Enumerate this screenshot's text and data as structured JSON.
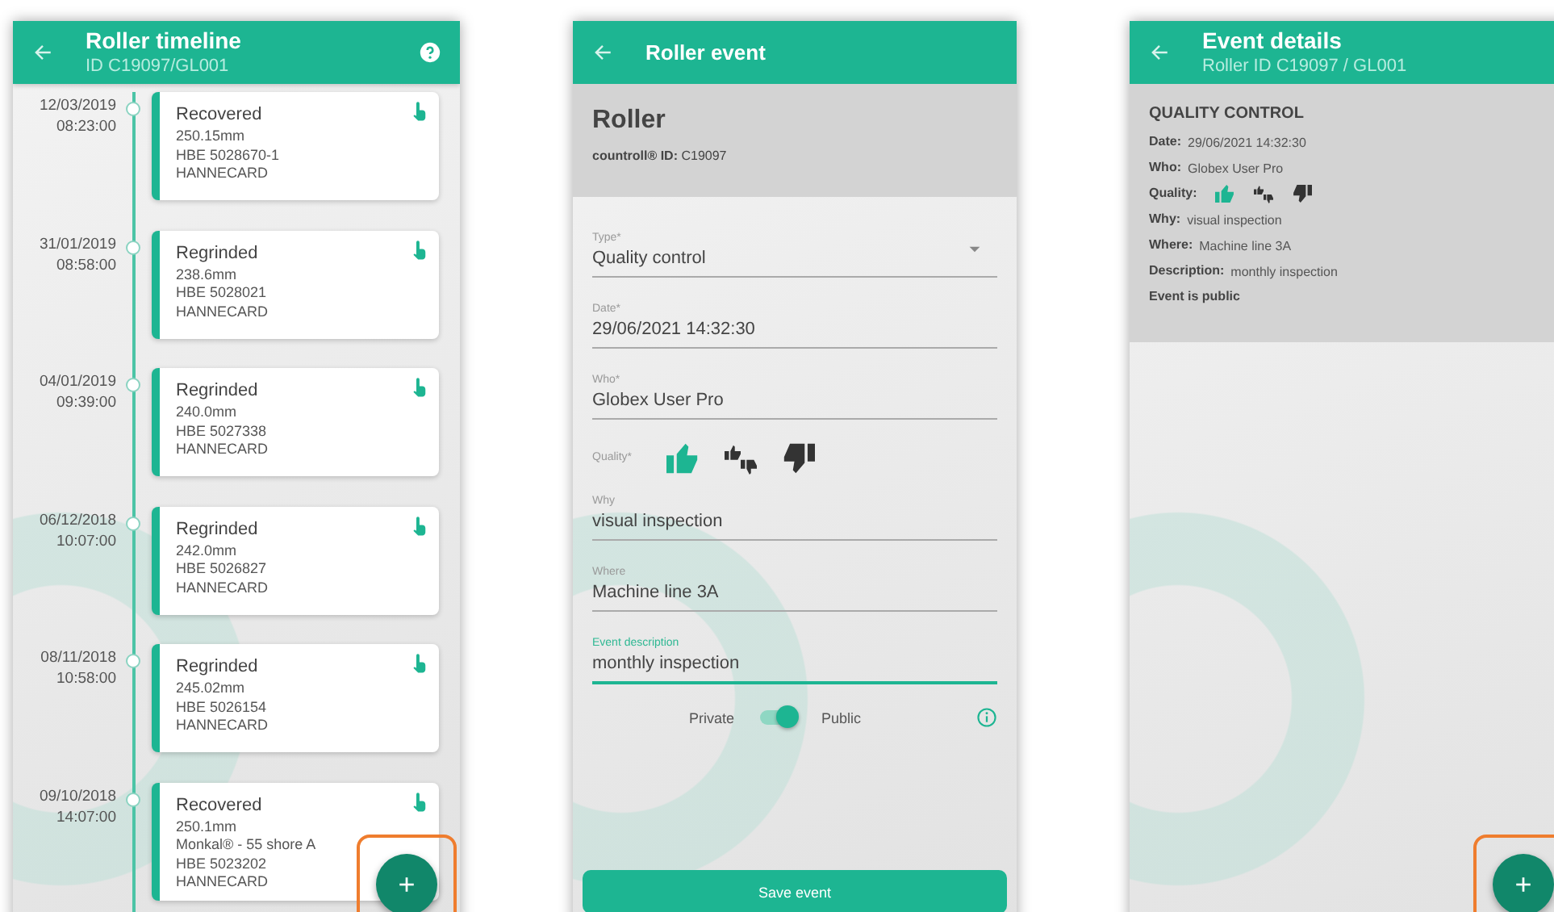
{
  "timeline": {
    "title": "Roller timeline",
    "subtitle": "ID C19097/GL001",
    "events": [
      {
        "date": "12/03/2019",
        "time": "08:23:00",
        "type": "Recovered",
        "lines": [
          "250.15mm",
          "HBE 5028670-1",
          "HANNECARD"
        ]
      },
      {
        "date": "31/01/2019",
        "time": "08:58:00",
        "type": "Regrinded",
        "lines": [
          "238.6mm",
          "HBE 5028021",
          "HANNECARD"
        ]
      },
      {
        "date": "04/01/2019",
        "time": "09:39:00",
        "type": "Regrinded",
        "lines": [
          "240.0mm",
          "HBE 5027338",
          "HANNECARD"
        ]
      },
      {
        "date": "06/12/2018",
        "time": "10:07:00",
        "type": "Regrinded",
        "lines": [
          "242.0mm",
          "HBE 5026827",
          "HANNECARD"
        ]
      },
      {
        "date": "08/11/2018",
        "time": "10:58:00",
        "type": "Regrinded",
        "lines": [
          "245.02mm",
          "HBE 5026154",
          "HANNECARD"
        ]
      },
      {
        "date": "09/10/2018",
        "time": "14:07:00",
        "type": "Recovered",
        "lines": [
          "250.1mm",
          "Monkal® - 55 shore A",
          "HBE 5023202",
          "HANNECARD"
        ]
      }
    ],
    "fab": {
      "label": "+",
      "highlighted": true
    }
  },
  "event_form": {
    "title": "Roller event",
    "heading": "Roller",
    "id_line": "**countroll® ID:** C19097",
    "fields": [
      {
        "kind": "select",
        "label": "Type*",
        "value": "Quality control",
        "focused": false
      },
      {
        "kind": "text",
        "label": "Date*",
        "value": "29/06/2021 14:32:30",
        "focused": false
      },
      {
        "kind": "text",
        "label": "Who*",
        "value": "Globex User Pro",
        "focused": false
      },
      {
        "kind": "quality",
        "label": "Quality*",
        "options": [
          {
            "kind": "good",
            "selected": true
          },
          {
            "kind": "mixed",
            "selected": false
          },
          {
            "kind": "bad",
            "selected": false
          }
        ]
      },
      {
        "kind": "text",
        "label": "Why",
        "value": "visual inspection",
        "focused": false
      },
      {
        "kind": "text",
        "label": "Where",
        "value": "Machine line 3A",
        "focused": false
      },
      {
        "kind": "text",
        "label": "Event description",
        "value": "monthly inspection",
        "focused": true
      }
    ],
    "visibility": {
      "off_label": "Private",
      "on_label": "Public",
      "on": true
    },
    "save_button": "Save event"
  },
  "event_details": {
    "title": "Event details",
    "subtitle": "Roller ID C19097 / GL001",
    "heading": "QUALITY CONTROL",
    "rows": [
      {
        "kind": "text",
        "label": "Date:",
        "value": "29/06/2021 14:32:30"
      },
      {
        "kind": "text",
        "label": "Who:",
        "value": "Globex User Pro"
      },
      {
        "kind": "quality",
        "label": "Quality:",
        "options": [
          {
            "kind": "good",
            "selected": true
          },
          {
            "kind": "mixed",
            "selected": false
          },
          {
            "kind": "bad",
            "selected": false
          }
        ]
      },
      {
        "kind": "text",
        "label": "Why:",
        "value": "visual inspection"
      },
      {
        "kind": "text",
        "label": "Where:",
        "value": "Machine line 3A"
      },
      {
        "kind": "text",
        "label": "Description:",
        "value": "monthly inspection"
      },
      {
        "kind": "note",
        "label": "Event is public"
      }
    ],
    "fab": {
      "label": "+",
      "highlighted": true
    }
  }
}
